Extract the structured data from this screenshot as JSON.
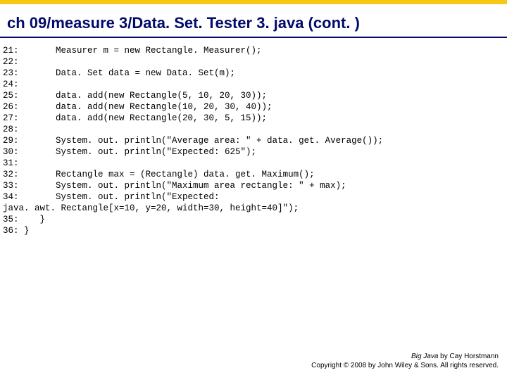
{
  "header": {
    "title": "ch 09/measure 3/Data. Set. Tester 3. java  (cont. )"
  },
  "code": {
    "text": "21:       Measurer m = new Rectangle. Measurer();\n22: \n23:       Data. Set data = new Data. Set(m);\n24: \n25:       data. add(new Rectangle(5, 10, 20, 30));\n26:       data. add(new Rectangle(10, 20, 30, 40));\n27:       data. add(new Rectangle(20, 30, 5, 15));\n28: \n29:       System. out. println(\"Average area: \" + data. get. Average());\n30:       System. out. println(\"Expected: 625\");\n31: \n32:       Rectangle max = (Rectangle) data. get. Maximum();\n33:       System. out. println(\"Maximum area rectangle: \" + max);\n34:       System. out. println(\"Expected: \njava. awt. Rectangle[x=10, y=20, width=30, height=40]\");\n35:    }\n36: }"
  },
  "footer": {
    "booktitle": "Big Java",
    "byline": " by Cay Horstmann",
    "copyright": "Copyright © 2008 by John Wiley & Sons. All rights reserved."
  }
}
